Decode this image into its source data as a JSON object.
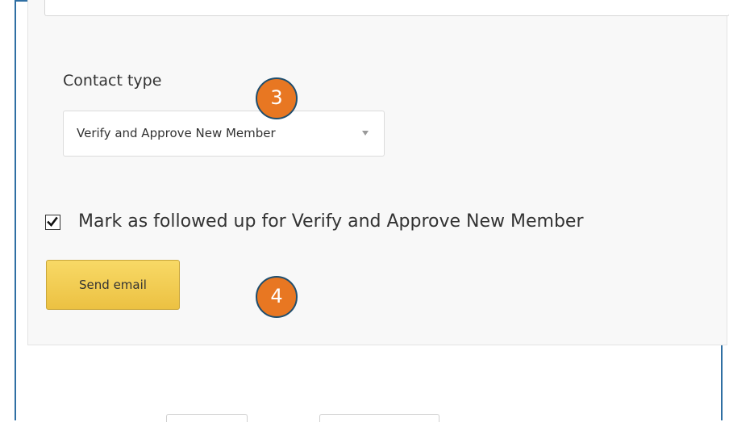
{
  "contact_type": {
    "label": "Contact type",
    "selected_value": "Verify and Approve New Member"
  },
  "follow_up": {
    "checked": true,
    "label": "Mark as followed up for Verify and Approve New Member"
  },
  "send_button": {
    "label": "Send email"
  },
  "step_badges": {
    "step_3": "3",
    "step_4": "4"
  },
  "colors": {
    "frame_border": "#2f6fa3",
    "panel_background": "#f8f8f8",
    "button_yellow": "#f1c94f",
    "badge_orange": "#e87722",
    "badge_border": "#1f4e6e"
  },
  "icons": {
    "dropdown": "chevron-down-icon",
    "checkbox": "checkmark-icon"
  }
}
